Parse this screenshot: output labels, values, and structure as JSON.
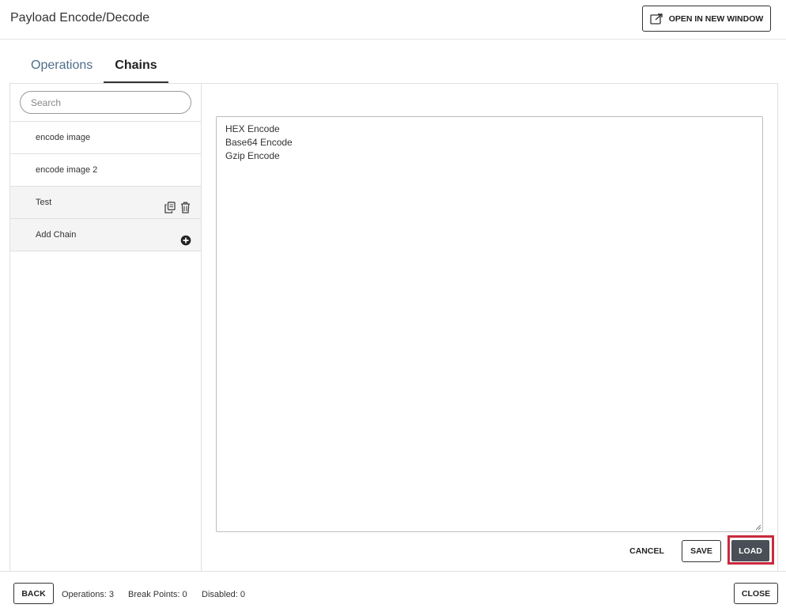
{
  "header": {
    "title": "Payload Encode/Decode",
    "open_new_window_label": "OPEN IN NEW WINDOW"
  },
  "tabs": [
    {
      "label": "Operations",
      "active": false
    },
    {
      "label": "Chains",
      "active": true
    }
  ],
  "sidebar": {
    "search_placeholder": "Search",
    "items": [
      {
        "label": "encode image"
      },
      {
        "label": "encode image 2"
      },
      {
        "label": "Test",
        "icons": [
          "copy-icon",
          "trash-icon"
        ]
      },
      {
        "label": "Add Chain",
        "icons": [
          "plus-circle-icon"
        ]
      }
    ]
  },
  "editor": {
    "lines": [
      "HEX Encode",
      "Base64 Encode",
      "Gzip Encode"
    ]
  },
  "actions": {
    "cancel_label": "CANCEL",
    "save_label": "SAVE",
    "load_label": "LOAD"
  },
  "footer": {
    "back_label": "BACK",
    "operations": "Operations: 3",
    "break_points": "Break Points: 0",
    "disabled": "Disabled: 0",
    "close_label": "CLOSE"
  },
  "colors": {
    "tab_inactive": "#4f6d8a",
    "load_button": "#4a4e57",
    "highlight": "#c92a3e"
  }
}
